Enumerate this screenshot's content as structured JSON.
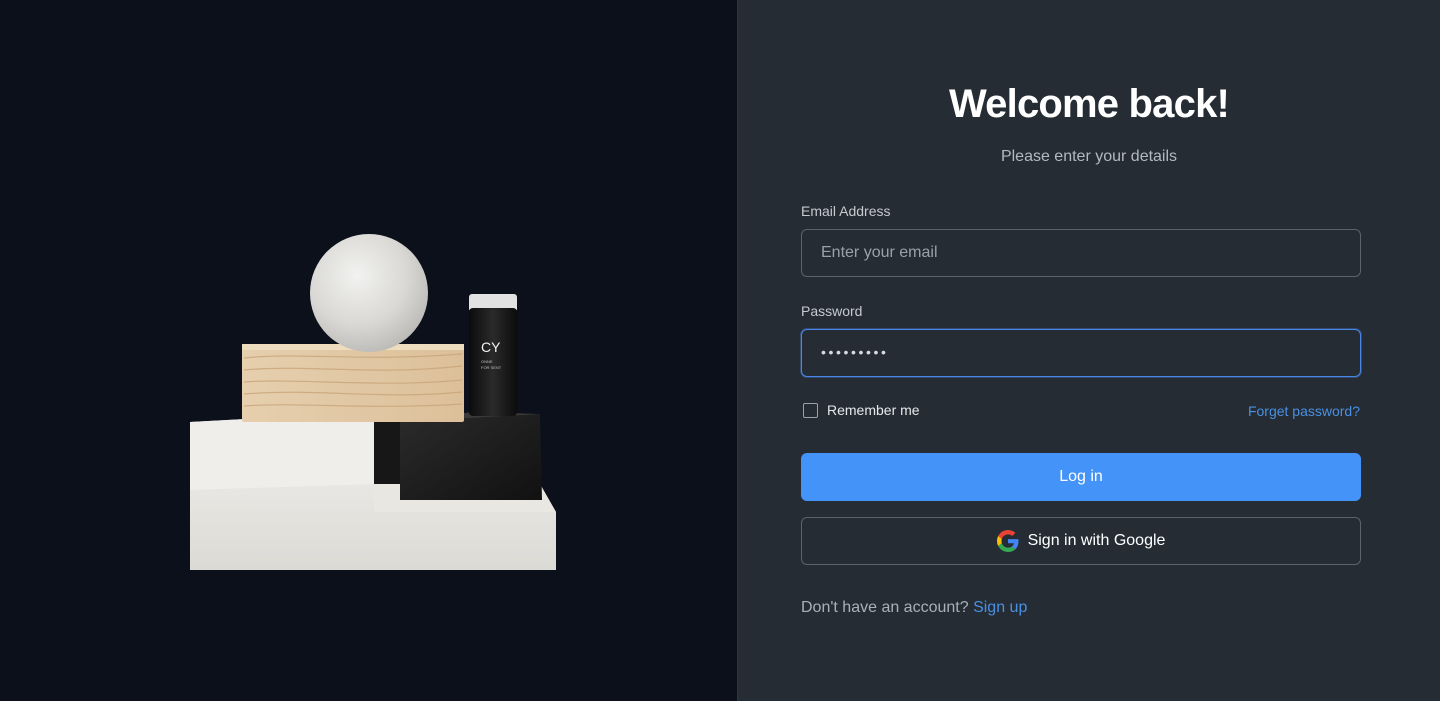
{
  "hero": {
    "product_label_brand": "CY",
    "product_label_small_line1": "ONNE",
    "product_label_small_line2": "FOR SENT"
  },
  "login": {
    "title": "Welcome back!",
    "subtitle": "Please enter your details",
    "email_label": "Email Address",
    "email_placeholder": "Enter your email",
    "email_value": "",
    "password_label": "Password",
    "password_value": "•••••••••",
    "remember_label": "Remember me",
    "remember_checked": false,
    "forgot_label": "Forget password?",
    "login_button_label": "Log in",
    "google_button_label": "Sign in with Google",
    "signup_prompt": "Don't have an account?",
    "signup_link_label": "Sign up"
  },
  "colors": {
    "hero_background": "#0b101b",
    "panel_background": "#252c34",
    "primary_button": "#4493f8",
    "link": "#4a90e2",
    "focus_border": "#4a86e8"
  },
  "icons": {
    "google": "google-g-logo",
    "checkbox": "checkbox-unchecked"
  }
}
